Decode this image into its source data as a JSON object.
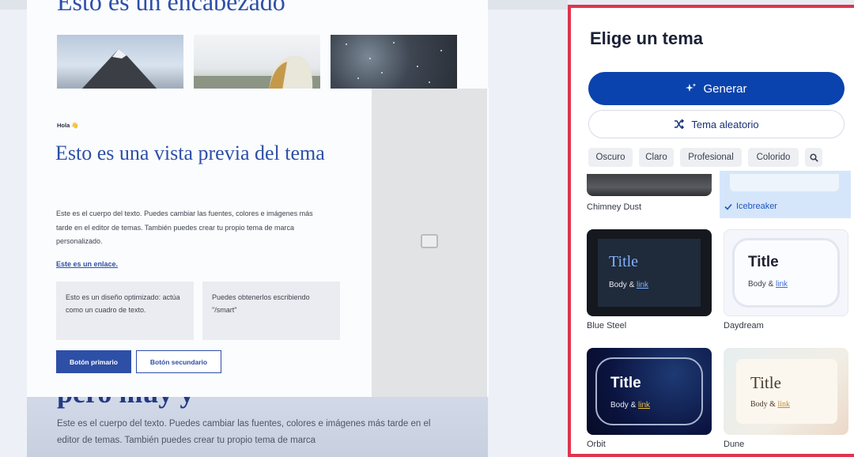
{
  "canvas": {
    "slide_heading": "Esto es un encabezado",
    "bottom_heading": "pero muy y",
    "bottom_body": "Este es el cuerpo del texto. Puedes cambiar las fuentes, colores e imágenes más tarde en el editor de temas. También puedes crear tu propio tema de marca",
    "preview": {
      "greeting": "Hola 👋",
      "title": "Esto es una vista previa del tema",
      "body": "Este es el cuerpo del texto. Puedes cambiar las fuentes, colores e imágenes más tarde en el editor de temas. También puedes crear tu propio tema de marca personalizado.",
      "link": "Este es un enlace.",
      "box1": "Esto es un diseño optimizado: actúa como un cuadro de texto.",
      "box2": "Puedes obtenerlos escribiendo \"/smart\"",
      "primary_button": "Botón primario",
      "secondary_button": "Botón secundario",
      "accent_color": "#2d4fa6"
    },
    "photos": [
      "mountain-photo",
      "tent-photo",
      "night-sky-photo"
    ]
  },
  "panel": {
    "title": "Elige un tema",
    "generate_label": "Generar",
    "random_label": "Tema aleatorio",
    "filters": [
      "Oscuro",
      "Claro",
      "Profesional",
      "Colorido"
    ],
    "themes": [
      {
        "name": "Chimney Dust",
        "selected": false
      },
      {
        "name": "Icebreaker",
        "selected": true
      },
      {
        "name": "Blue Steel",
        "title": "Title",
        "body": "Body & ",
        "link": "link",
        "selected": false
      },
      {
        "name": "Daydream",
        "title": "Title",
        "body": "Body & ",
        "link": "link",
        "selected": false
      },
      {
        "name": "Orbit",
        "title": "Title",
        "body": "Body & ",
        "link": "link",
        "selected": false
      },
      {
        "name": "Dune",
        "title": "Title",
        "body": "Body & ",
        "link": "link",
        "selected": false
      }
    ],
    "colors": {
      "highlight_border": "#e0344e",
      "generate_bg": "#0a43ad",
      "selected_bg": "#d5e6fb"
    },
    "icons": {
      "generate": "sparkle-icon",
      "random": "shuffle-icon",
      "search": "search-icon",
      "check": "check-icon"
    }
  }
}
